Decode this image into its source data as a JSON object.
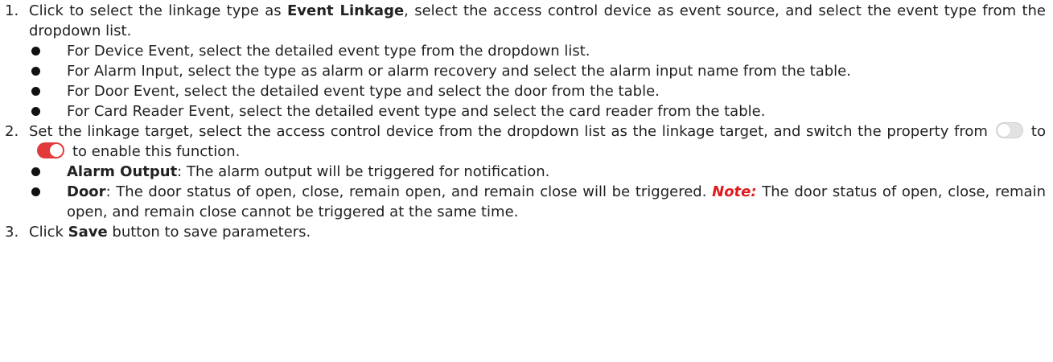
{
  "steps": [
    {
      "number": "1.",
      "pre": "Click to select the linkage type as ",
      "bold": "Event Linkage",
      "post": ", select the access control device as event source, and select the event type from the dropdown list.",
      "bullets": [
        "For Device Event, select the detailed event type from the dropdown list.",
        "For Alarm Input, select the type as alarm or alarm recovery and select the alarm input name from the table.",
        "For Door Event, select the detailed event type and select the door from the table.",
        "For Card Reader Event, select the detailed event type and select the card reader from the table."
      ]
    },
    {
      "number": "2.",
      "pre": "Set the linkage target, select the access control device from the dropdown list as the linkage target, and switch the property from",
      "mid": "to",
      "post": "to enable this function.",
      "toggle_off_state": "off",
      "toggle_on_state": "on",
      "toggle_on_color": "#e13a3a",
      "bullets": [
        {
          "term": "Alarm Output",
          "text": ": The alarm output will be triggered for notification."
        },
        {
          "term": "Door",
          "text": ": The door status of open, close, remain open, and remain close will be triggered. ",
          "note_label": "Note:",
          "note_text": " The door status of open, close, remain open, and remain close cannot be triggered at the same time."
        }
      ]
    },
    {
      "number": "3.",
      "pre": "Click ",
      "bold": "Save",
      "post": " button to save parameters."
    }
  ],
  "colors": {
    "note": "#e01b1b",
    "text": "#222222"
  }
}
